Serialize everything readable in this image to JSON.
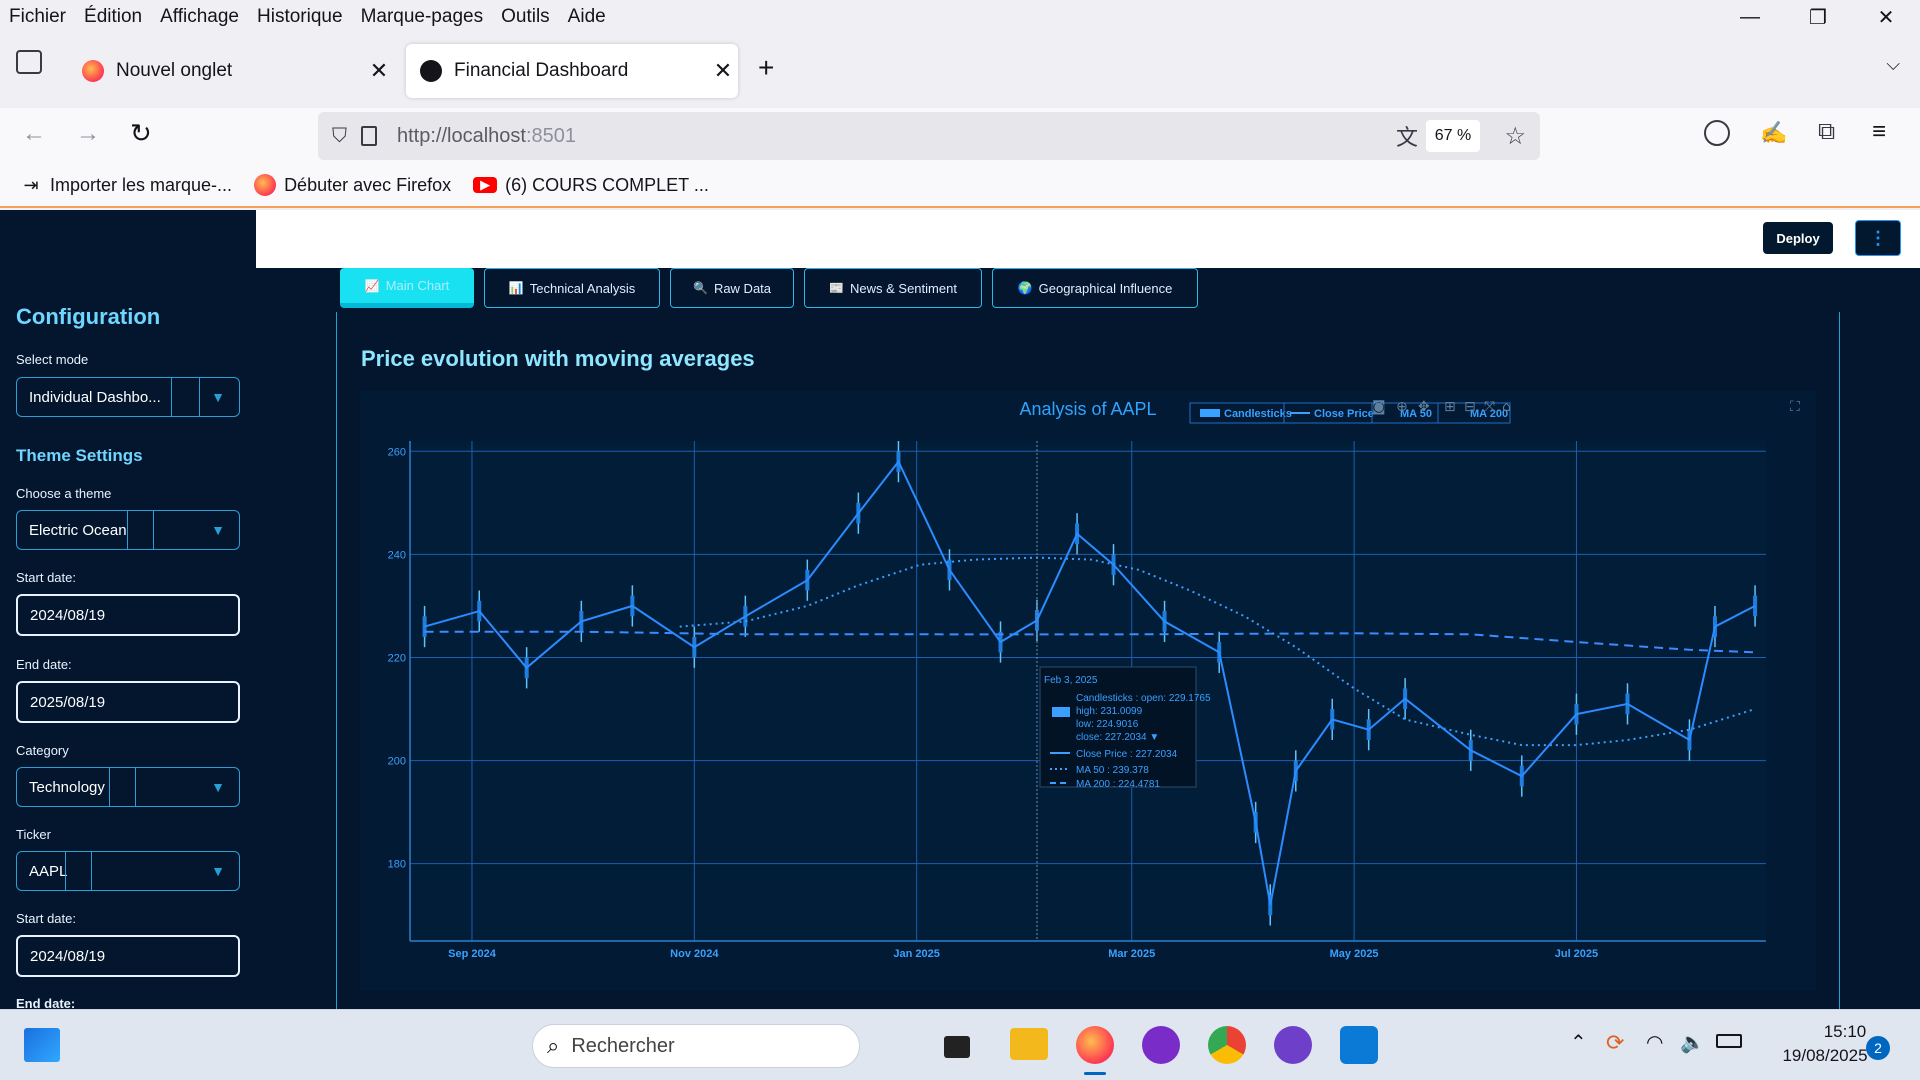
{
  "browser": {
    "menu": [
      "Fichier",
      "Édition",
      "Affichage",
      "Historique",
      "Marque-pages",
      "Outils",
      "Aide"
    ],
    "tabs": [
      {
        "label": "Nouvel onglet",
        "active": false
      },
      {
        "label": "Financial Dashboard",
        "active": true
      }
    ],
    "url_host": "http://localhost",
    "url_port": ":8501",
    "zoom": "67 %",
    "bookmarks": [
      "Importer les marque-...",
      "Débuter avec Firefox",
      "(6) COURS COMPLET ..."
    ]
  },
  "app": {
    "deploy_label": "Deploy",
    "sidebar": {
      "config_title": "Configuration",
      "mode_label": "Select mode",
      "mode_value": "Individual Dashbo...",
      "theme_title": "Theme Settings",
      "theme_label": "Choose a theme",
      "theme_value": "Electric Ocean",
      "start_label": "Start date:",
      "start_value": "2024/08/19",
      "end_label": "End date:",
      "end_value": "2025/08/19",
      "category_label": "Category",
      "category_value": "Technology",
      "ticker_label": "Ticker",
      "ticker_value": "AAPL",
      "start2_label": "Start date:",
      "start2_value": "2024/08/19",
      "end2_label": "End date:"
    },
    "tabs": [
      {
        "icon": "📈",
        "label": "Main Chart"
      },
      {
        "icon": "📊",
        "label": "Technical Analysis"
      },
      {
        "icon": "🔍",
        "label": "Raw Data"
      },
      {
        "icon": "📰",
        "label": "News & Sentiment"
      },
      {
        "icon": "🌍",
        "label": "Geographical Influence"
      }
    ],
    "section_title": "Price evolution with moving averages"
  },
  "chart_data": {
    "type": "line",
    "title": "Analysis of AAPL",
    "legend": [
      "Candlesticks",
      "Close Price",
      "MA 50",
      "MA 200"
    ],
    "legend_position": "top-right",
    "ylim": [
      165,
      262
    ],
    "y_ticks": [
      180,
      200,
      220,
      240,
      260
    ],
    "x_ticks": [
      "Sep 2024",
      "Nov 2024",
      "Jan 2025",
      "Mar 2025",
      "May 2025",
      "Jul 2025"
    ],
    "grid": true,
    "colors": {
      "price": "#1e7fe0",
      "ma50": "#3aa0ff",
      "ma200": "#3a8cff",
      "grid": "#1c5fb0",
      "text": "#3aa0ff"
    },
    "series": [
      {
        "name": "Close Price",
        "x": [
          "2024-08-19",
          "2024-09-03",
          "2024-09-16",
          "2024-10-01",
          "2024-10-15",
          "2024-11-01",
          "2024-11-15",
          "2024-12-02",
          "2024-12-16",
          "2024-12-27",
          "2025-01-10",
          "2025-01-24",
          "2025-02-03",
          "2025-02-14",
          "2025-02-24",
          "2025-03-10",
          "2025-03-25",
          "2025-04-04",
          "2025-04-08",
          "2025-04-15",
          "2025-04-25",
          "2025-05-05",
          "2025-05-15",
          "2025-06-02",
          "2025-06-16",
          "2025-07-01",
          "2025-07-15",
          "2025-08-01",
          "2025-08-08",
          "2025-08-19"
        ],
        "values": [
          226,
          229,
          218,
          227,
          230,
          222,
          228,
          235,
          248,
          258,
          237,
          223,
          227.2034,
          244,
          238,
          227,
          221,
          188,
          172,
          198,
          208,
          206,
          212,
          202,
          197,
          209,
          211,
          204,
          226,
          230
        ]
      },
      {
        "name": "MA 50",
        "x": [
          "2024-10-28",
          "2024-11-15",
          "2024-12-02",
          "2024-12-16",
          "2025-01-02",
          "2025-01-17",
          "2025-02-03",
          "2025-02-18",
          "2025-03-03",
          "2025-03-17",
          "2025-04-01",
          "2025-04-15",
          "2025-05-01",
          "2025-05-15",
          "2025-06-02",
          "2025-06-16",
          "2025-07-01",
          "2025-07-15",
          "2025-08-01",
          "2025-08-19"
        ],
        "values": [
          226,
          227,
          230,
          234,
          238,
          239,
          239.378,
          239,
          237,
          233,
          228,
          222,
          214,
          208,
          205,
          203,
          203,
          204,
          206,
          210
        ]
      },
      {
        "name": "MA 200",
        "x": [
          "2024-08-19",
          "2024-10-01",
          "2024-11-15",
          "2025-01-02",
          "2025-02-03",
          "2025-03-03",
          "2025-04-01",
          "2025-05-01",
          "2025-06-02",
          "2025-07-01",
          "2025-08-01",
          "2025-08-19"
        ],
        "values": [
          225,
          225,
          224.5,
          224.5,
          224.4781,
          224.5,
          224.6,
          224.7,
          224.5,
          223,
          221.5,
          221
        ]
      }
    ],
    "tooltip": {
      "date": "Feb 3, 2025",
      "candle": "Candlesticks : open: 229.1765",
      "high": "high: 231.0099",
      "low": "low: 224.9016",
      "close": "close: 227.2034 ▼",
      "close_price": "Close Price : 227.2034",
      "ma50": "MA 50 : 239.378",
      "ma200": "MA 200 : 224.4781"
    }
  },
  "taskbar": {
    "search_placeholder": "Rechercher",
    "time": "15:10",
    "date": "19/08/2025",
    "badge": "2"
  }
}
